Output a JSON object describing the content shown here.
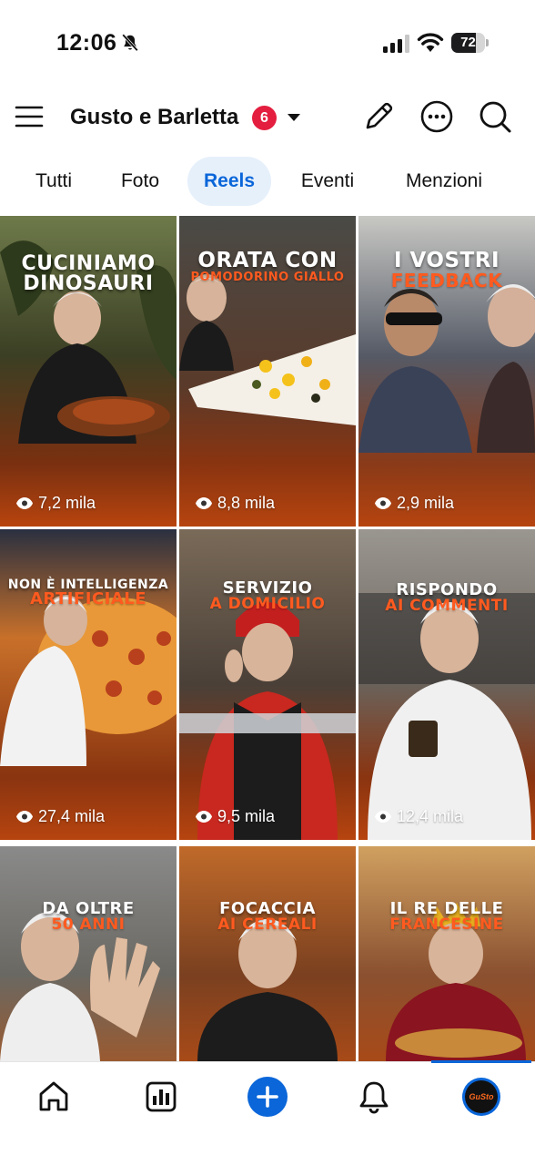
{
  "status_bar": {
    "time": "12:06",
    "battery_percent": 72,
    "battery_text": "72"
  },
  "header": {
    "title": "Gusto e Barletta",
    "notification_count": "6",
    "icons": [
      "menu-icon",
      "chevron-down-icon",
      "pencil-icon",
      "more-icon",
      "search-icon"
    ]
  },
  "tabs": [
    {
      "label": "Tutti",
      "active": false
    },
    {
      "label": "Foto",
      "active": false
    },
    {
      "label": "Reels",
      "active": true
    },
    {
      "label": "Eventi",
      "active": false
    },
    {
      "label": "Menzioni",
      "active": false
    }
  ],
  "reels": [
    {
      "line1": "CUCINIAMO",
      "line2": "DINOSAURI",
      "line2_color": "white",
      "views": "7,2 mila"
    },
    {
      "line1": "ORATA CON",
      "line2": "POMODORINO GIALLO",
      "line2_color": "orange",
      "views": "8,8 mila"
    },
    {
      "line1": "I VOSTRI",
      "line2": "FEEDBACK",
      "line2_color": "orange",
      "views": "2,9 mila"
    },
    {
      "line1": "NON È INTELLIGENZA",
      "line2": "ARTIFICIALE",
      "line2_color": "orange",
      "views": "27,4 mila"
    },
    {
      "line1": "SERVIZIO",
      "line2": "A DOMICILIO",
      "line2_color": "orange",
      "views": "9,5 mila"
    },
    {
      "line1": "RISPONDO",
      "line2": "AI COMMENTI",
      "line2_color": "orange",
      "views": "12,4 mila"
    },
    {
      "line1": "DA OLTRE",
      "line2": "50 ANNI",
      "line2_color": "orange",
      "views": ""
    },
    {
      "line1": "FOCACCIA",
      "line2": "AI CEREALI",
      "line2_color": "orange",
      "views": ""
    },
    {
      "line1": "IL RE DELLE",
      "line2": "FRANCESINE",
      "line2_color": "orange",
      "views": ""
    }
  ],
  "bottom_nav": {
    "icons": [
      "home-icon",
      "insights-icon",
      "plus-icon",
      "bell-icon",
      "profile-avatar"
    ],
    "avatar_text": "GuSto"
  },
  "colors": {
    "accent": "#0a66d9",
    "badge": "#e41e3f",
    "tab_active_bg": "#e6f0fb",
    "headline_orange": "#ff5a1f"
  }
}
